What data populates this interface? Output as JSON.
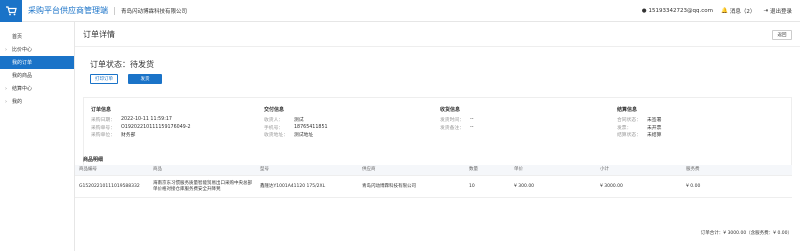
{
  "header": {
    "app_title": "采购平台供应商管理端",
    "company": "青岛闪动博霖科技有限公司",
    "account": "15193342723@qq.com",
    "messages_label": "消息（2）",
    "logout_label": "退出登录",
    "brand_color": "#1a73c8"
  },
  "sidebar": {
    "items": [
      {
        "label": "首页",
        "group": false,
        "active": false
      },
      {
        "label": "比价中心",
        "group": true,
        "active": false
      },
      {
        "label": "我的订单",
        "group": false,
        "active": true
      },
      {
        "label": "我的商品",
        "group": false,
        "active": false
      },
      {
        "label": "结算中心",
        "group": true,
        "active": false
      },
      {
        "label": "我的",
        "group": true,
        "active": false
      }
    ]
  },
  "page": {
    "title": "订单详情",
    "back_label": "返回",
    "status_text": "订单状态：待发货",
    "print_label": "打印订单",
    "ship_label": "发货"
  },
  "order_info": {
    "heading": "订单信息",
    "rows": [
      {
        "k": "采购日期：",
        "v": "2022-10-11 11:59:17"
      },
      {
        "k": "采购单号：",
        "v": "O19202210111159176049-2"
      },
      {
        "k": "采购单位：",
        "v": "财务部"
      }
    ]
  },
  "delivery_info": {
    "heading": "交付信息",
    "rows": [
      {
        "k": "收货人：",
        "v": "测试"
      },
      {
        "k": "手机号：",
        "v": "18765411851"
      },
      {
        "k": "收货地址：",
        "v": "测试地址"
      }
    ]
  },
  "receipt_info": {
    "heading": "收货信息",
    "rows": [
      {
        "k": "发货时间：",
        "v": "--"
      },
      {
        "k": "发货备注：",
        "v": "--"
      }
    ]
  },
  "settle_info": {
    "heading": "结算信息",
    "rows": [
      {
        "k": "合同状态：",
        "v": "未签署"
      },
      {
        "k": "发票：",
        "v": "未开票"
      },
      {
        "k": "结算状态：",
        "v": "未结算"
      }
    ]
  },
  "goods": {
    "label": "商品明细",
    "columns": [
      "商品编号",
      "商品",
      "型号",
      "供应商",
      "数量",
      "单价",
      "小计",
      "服务费"
    ],
    "rows": [
      [
        "G15202210111019588332",
        "海南京东习惯服务质量智能贸易出口采购中央总部单价格对接仓库服务费安全升降凳",
        "鑫隆达Y1001A41120 175/2XL",
        "青岛闪动博霖科技有限公司",
        "10",
        "¥ 300.00",
        "¥ 3000.00",
        "¥ 0.00"
      ]
    ],
    "total_text": "订单合计：¥ 3000.00（含服务费：¥ 0.00）"
  }
}
